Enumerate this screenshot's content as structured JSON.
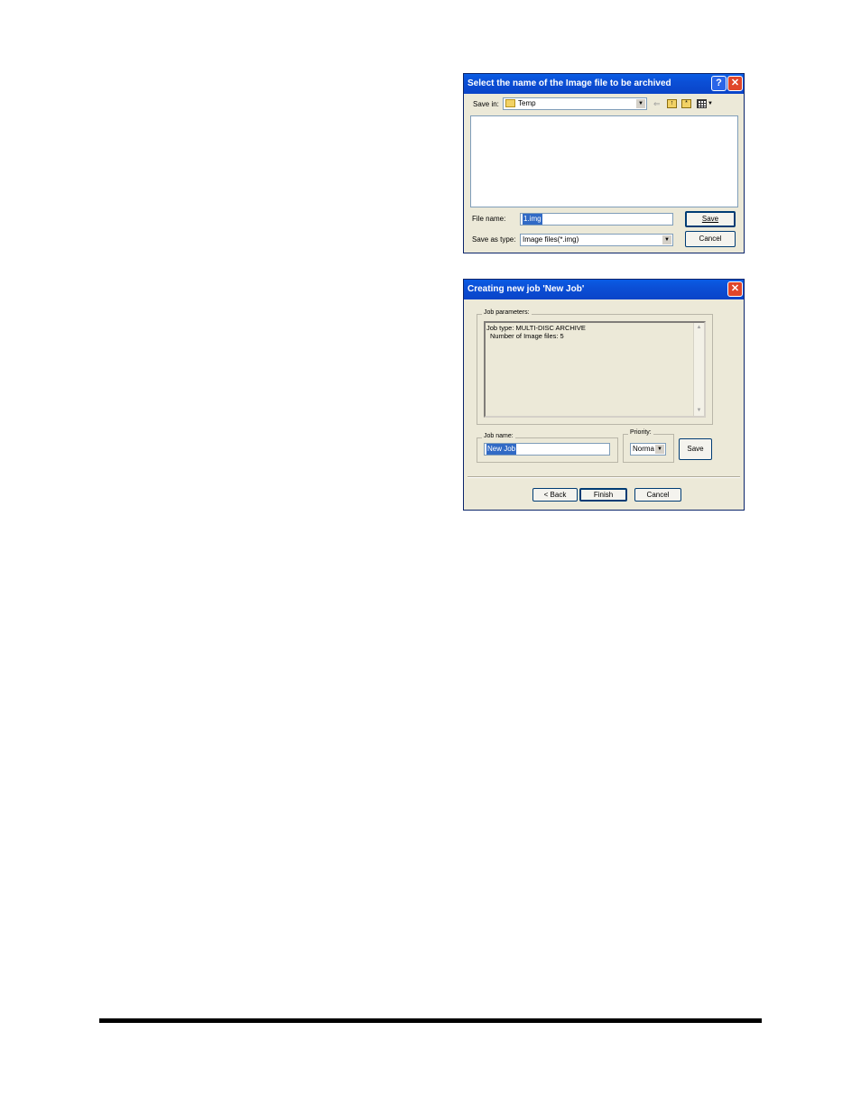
{
  "save_dialog": {
    "title": "Select the name of the Image file to be archived",
    "help_glyph": "?",
    "close_glyph": "✕",
    "save_in_label": "Save in:",
    "save_in_value": "Temp",
    "file_name_label": "File name:",
    "file_name_value": "1.img",
    "save_as_type_label": "Save as type:",
    "save_as_type_value": "Image files(*.img)",
    "save_button": "Save",
    "cancel_button": "Cancel",
    "icons": [
      "folder-icon",
      "back-arrow-icon",
      "up-folder-icon",
      "new-folder-icon",
      "view-menu-icon"
    ]
  },
  "job_dialog": {
    "title": "Creating new job 'New Job'",
    "close_glyph": "✕",
    "params_group_label": "Job parameters:",
    "params_line1": "Job type: MULTI-DISC ARCHIVE",
    "params_line2": "Number of Image files: 5",
    "job_name_label": "Job name:",
    "job_name_value": "New Job",
    "priority_label": "Priority:",
    "priority_value": "Normal",
    "save_button": "Save",
    "back_button": "< Back",
    "finish_button": "Finish",
    "cancel_button": "Cancel"
  }
}
